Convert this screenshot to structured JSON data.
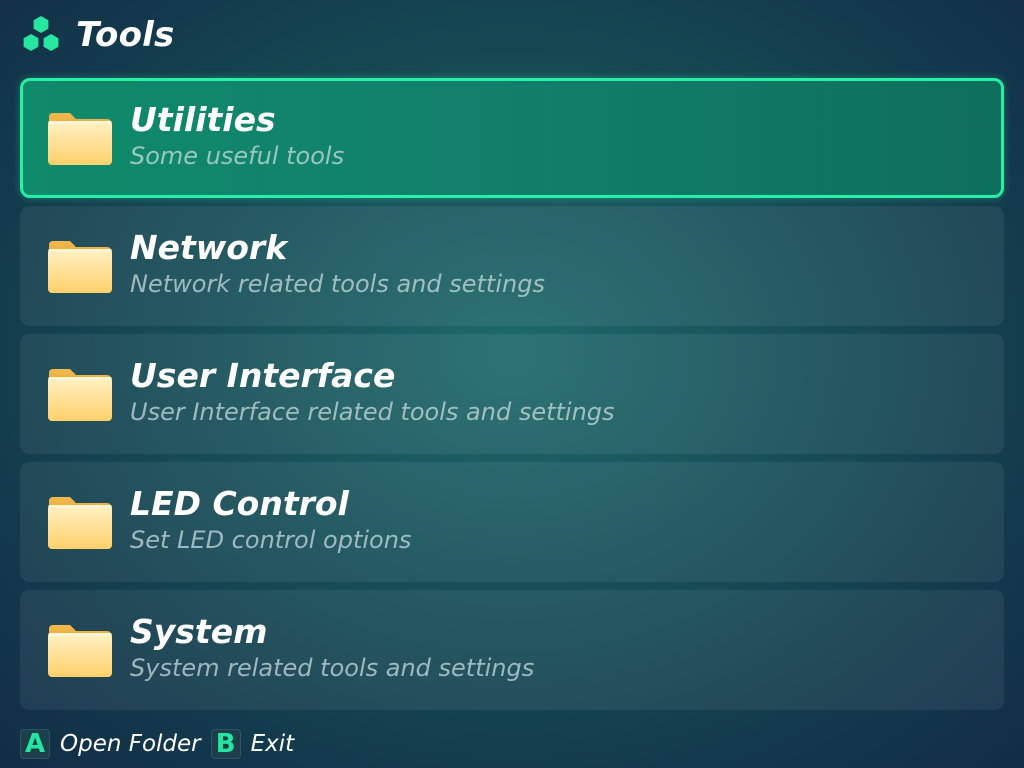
{
  "header": {
    "title": "Tools",
    "logo_icon": "hexagon-cluster-icon",
    "accent_color": "#26e6a0"
  },
  "items": [
    {
      "label": "Utilities",
      "description": "Some useful tools",
      "icon": "folder-icon",
      "selected": true
    },
    {
      "label": "Network",
      "description": "Network related tools and settings",
      "icon": "folder-icon",
      "selected": false
    },
    {
      "label": "User Interface",
      "description": "User Interface related tools and settings",
      "icon": "folder-icon",
      "selected": false
    },
    {
      "label": "LED Control",
      "description": "Set LED control options",
      "icon": "folder-icon",
      "selected": false
    },
    {
      "label": "System",
      "description": "System related tools and settings",
      "icon": "folder-icon",
      "selected": false
    }
  ],
  "footer": {
    "hints": [
      {
        "key": "A",
        "label": "Open Folder"
      },
      {
        "key": "B",
        "label": "Exit"
      }
    ]
  },
  "colors": {
    "selected_bg": "#0f8a6a",
    "selected_border": "#26f0a6",
    "folder": "#ffd87a"
  }
}
